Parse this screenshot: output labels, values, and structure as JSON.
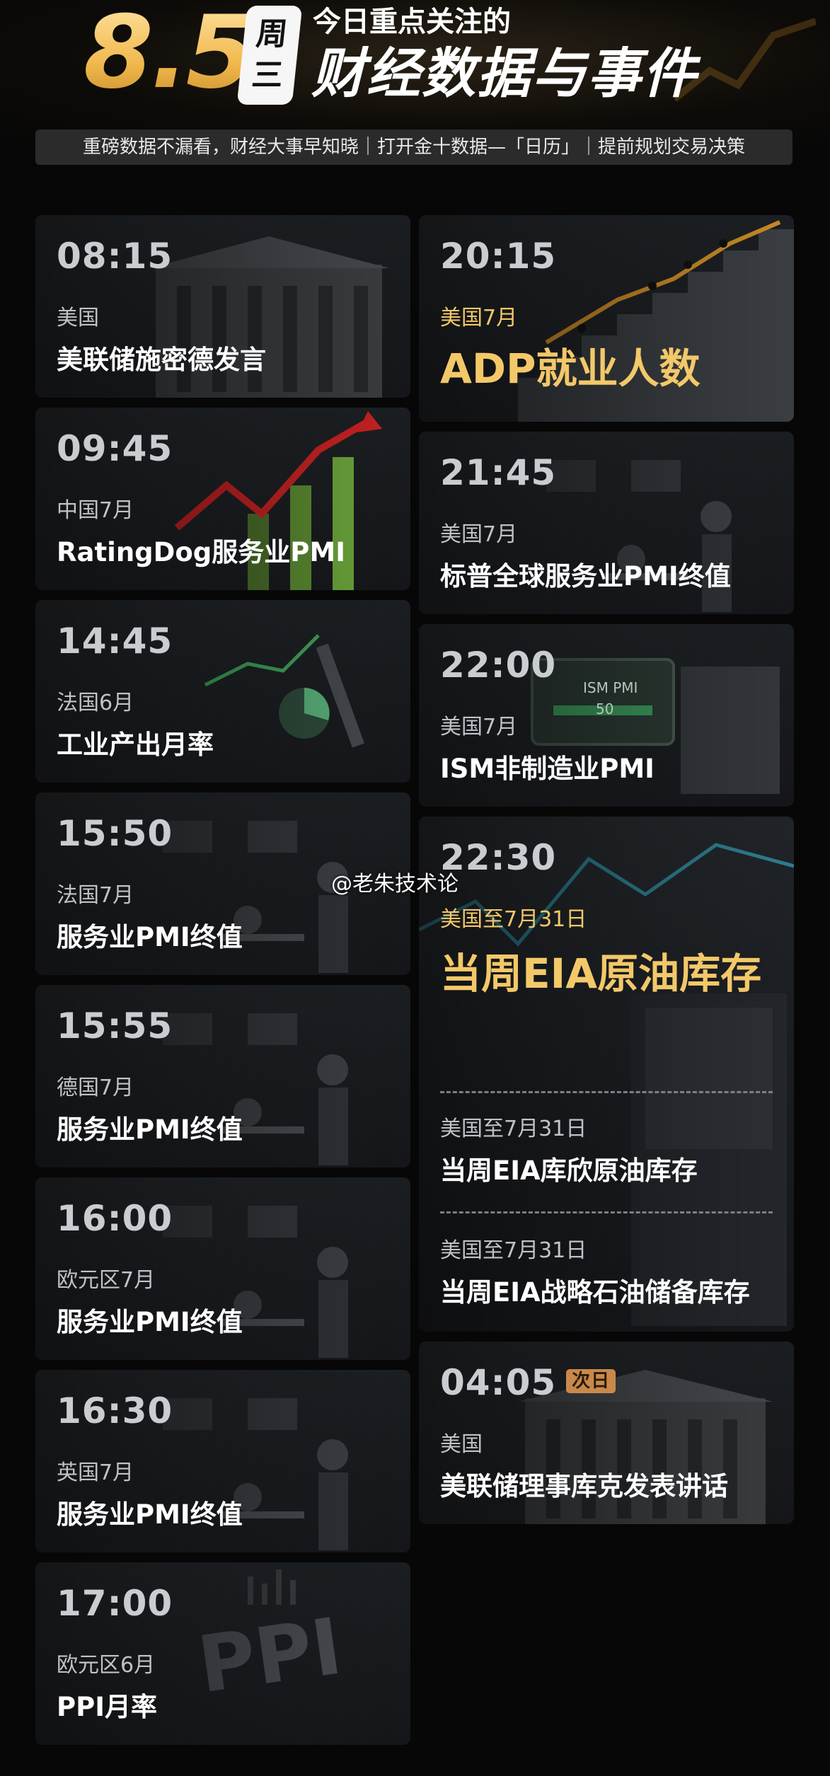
{
  "header": {
    "date": "8.5",
    "weekday_line1": "周",
    "weekday_line2": "三",
    "title_small": "今日重点关注的",
    "title_big": "财经数据与事件",
    "tagline": "重磅数据不漏看，财经大事早知晓｜打开金十数据—「日历」｜提前规划交易决策",
    "accent_color": "#f3c869"
  },
  "left_column": [
    {
      "time": "08:15",
      "region": "美国",
      "event": "美联储施密德发言",
      "bg_icon": "federal-reserve-building"
    },
    {
      "time": "09:45",
      "region": "中国7月",
      "event": "RatingDog服务业PMI",
      "bg_icon": "rising-chart-arrow"
    },
    {
      "time": "14:45",
      "region": "法国6月",
      "event": "工业产出月率",
      "bg_icon": "factory-robot-arm"
    },
    {
      "time": "15:50",
      "region": "法国7月",
      "event": "服务业PMI终值",
      "bg_icon": "office-workers"
    },
    {
      "time": "15:55",
      "region": "德国7月",
      "event": "服务业PMI终值",
      "bg_icon": "office-workers"
    },
    {
      "time": "16:00",
      "region": "欧元区7月",
      "event": "服务业PMI终值",
      "bg_icon": "office-workers"
    },
    {
      "time": "16:30",
      "region": "英国7月",
      "event": "服务业PMI终值",
      "bg_icon": "office-workers"
    },
    {
      "time": "17:00",
      "region": "欧元区6月",
      "event": "PPI月率",
      "bg_icon": "ppi-letters"
    }
  ],
  "right_column": {
    "adp": {
      "time": "20:15",
      "region": "美国7月",
      "event": "ADP就业人数",
      "bg_icon": "people-climbing-stairs"
    },
    "sp": {
      "time": "21:45",
      "region": "美国7月",
      "event": "标普全球服务业PMI终值",
      "bg_icon": "office-workers"
    },
    "ism": {
      "time": "22:00",
      "region": "美国7月",
      "event": "ISM非制造业PMI",
      "bg_icon": "ism-pmi-machine",
      "screen_title": "ISM PMI",
      "screen_value": "50"
    },
    "eia": {
      "time": "22:30",
      "region": "美国至7月31日",
      "event": "当周EIA原油库存",
      "sub": [
        {
          "region": "美国至7月31日",
          "event": "当周EIA库欣原油库存"
        },
        {
          "region": "美国至7月31日",
          "event": "当周EIA战略石油储备库存"
        }
      ],
      "bg_icon": "oil-tank"
    },
    "fed": {
      "time": "04:05",
      "badge": "次日",
      "region": "美国",
      "event": "美联储理事库克发表讲话",
      "bg_icon": "federal-reserve-building"
    }
  },
  "watermark": "@老朱技术论"
}
